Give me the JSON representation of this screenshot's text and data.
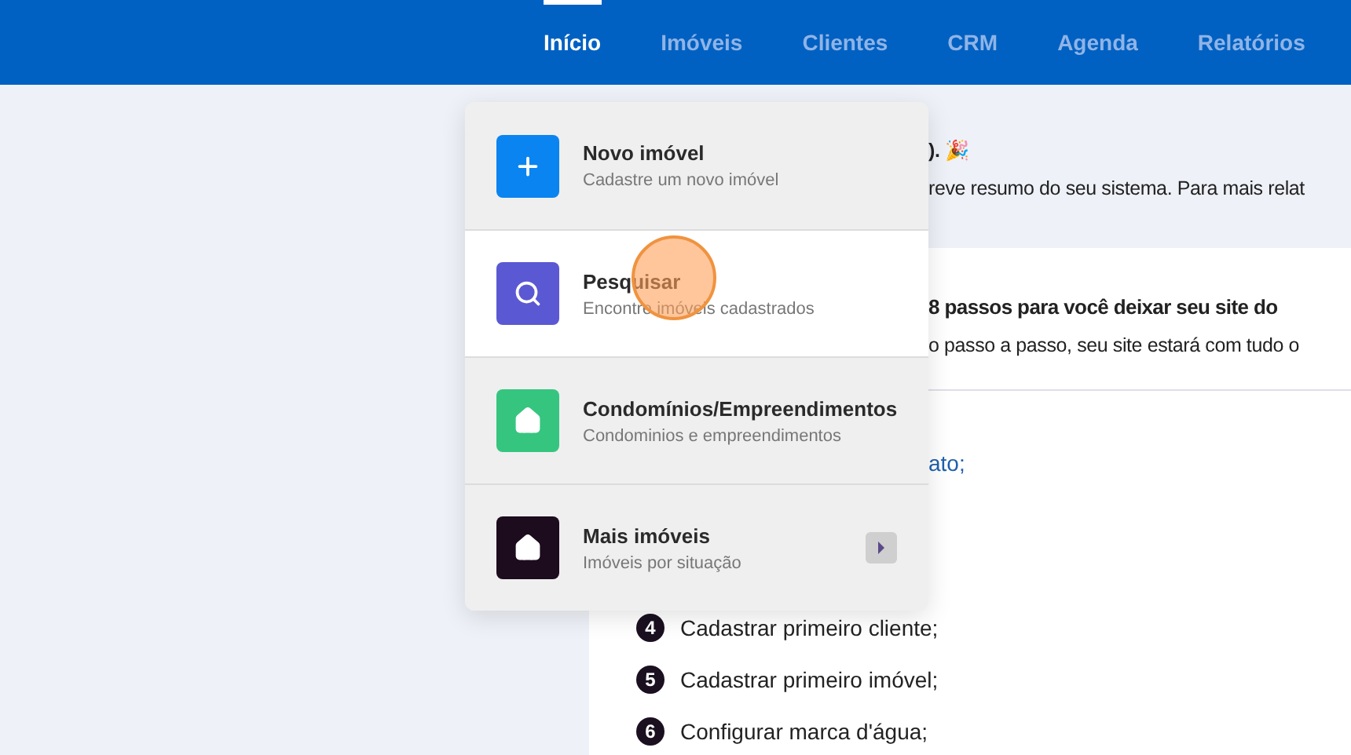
{
  "nav": [
    {
      "label": "Início",
      "selected": true
    },
    {
      "label": "Imóveis",
      "selected": false
    },
    {
      "label": "Clientes",
      "selected": false
    },
    {
      "label": "CRM",
      "selected": false
    },
    {
      "label": "Agenda",
      "selected": false
    },
    {
      "label": "Relatórios",
      "selected": false
    }
  ],
  "welcome": {
    "title_tail": ").",
    "emoji": "🎉",
    "text": "reve resumo do seu sistema. Para mais relat"
  },
  "guide": {
    "title": "8 passos para você deixar seu site do",
    "text": "o passo a passo, seu site estará com tudo o",
    "link": "ato;",
    "steps": [
      {
        "number": "4",
        "label": "Cadastrar primeiro cliente;"
      },
      {
        "number": "5",
        "label": "Cadastrar primeiro imóvel;"
      },
      {
        "number": "6",
        "label": "Configurar marca d'água;"
      }
    ]
  },
  "menu": [
    {
      "title": "Novo imóvel",
      "subtitle": "Cadastre um novo imóvel",
      "kind": "plus",
      "color": "#0a84f0",
      "highlighted": false,
      "submenu": false
    },
    {
      "title": "Pesquisar",
      "subtitle": "Encontre imóveis cadastrados",
      "kind": "search",
      "color": "#5b58d4",
      "highlighted": true,
      "submenu": false
    },
    {
      "title": "Condomínios/Empreendimentos",
      "subtitle": "Condominios e empreendimentos",
      "kind": "house",
      "color": "#36c57f",
      "highlighted": false,
      "submenu": false
    },
    {
      "title": "Mais imóveis",
      "subtitle": "Imóveis por situação",
      "kind": "house",
      "color": "#1d0c1d",
      "highlighted": false,
      "submenu": true
    }
  ]
}
